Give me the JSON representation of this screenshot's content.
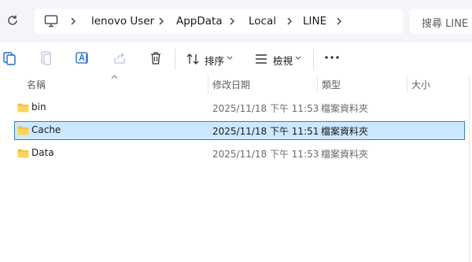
{
  "breadcrumb": {
    "items": [
      "lenovo User",
      "AppData",
      "Local",
      "LINE"
    ]
  },
  "search": {
    "placeholder": "搜尋 LINE"
  },
  "toolbar": {
    "sort_label": "排序",
    "view_label": "檢視",
    "icons": [
      "new-icon",
      "copy-icon",
      "rename-icon",
      "share-icon",
      "delete-icon"
    ]
  },
  "columns": {
    "name": "名稱",
    "date": "修改日期",
    "type": "類型",
    "size": "大小"
  },
  "files": [
    {
      "name": "bin",
      "date": "2025/11/18 下午 11:53",
      "type": "檔案資料夾",
      "selected": false
    },
    {
      "name": "Cache",
      "date": "2025/11/18 下午 11:51",
      "type": "檔案資料夾",
      "selected": true
    },
    {
      "name": "Data",
      "date": "2025/11/18 下午 11:53",
      "type": "檔案資料夾",
      "selected": false
    }
  ],
  "colors": {
    "selection": "#cce8ff",
    "selection_border": "#3d7fb7",
    "folder": "#f4c242"
  }
}
